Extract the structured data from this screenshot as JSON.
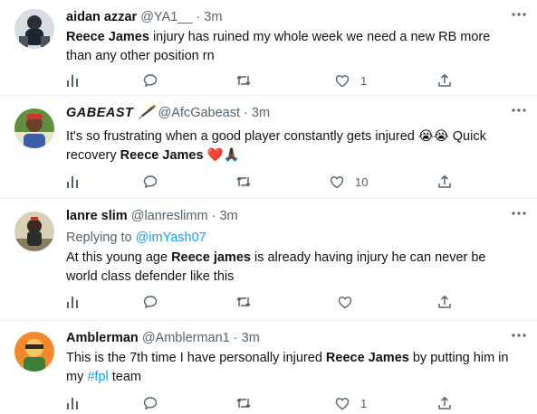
{
  "tweets": [
    {
      "name": "aidan azzar",
      "handle": "@YA1__",
      "dot": "·",
      "time": "3m",
      "text_parts": [
        "",
        "Reece James",
        " injury has ruined my whole week we need a new RB more than any other position rn"
      ],
      "like_count": "1",
      "retweet_count": "",
      "reply_count": ""
    },
    {
      "name": "GABEAST",
      "handle": "@AfcGabeast",
      "dot": "·",
      "time": "3m",
      "text_parts": [
        "It's so frustrating when a good player constantly gets injured ",
        "😭😭",
        " Quick recovery ",
        "Reece James",
        " ",
        "❤️🙏🏿"
      ],
      "like_count": "10",
      "retweet_count": "",
      "reply_count": ""
    },
    {
      "name": "lanre slim",
      "handle": "@lanreslimm",
      "dot": "·",
      "time": "3m",
      "replying_to_label": "Replying to ",
      "replying_to_handle": "@imYash07",
      "text_parts": [
        "At this young age ",
        "Reece james",
        " is already having injury he can never be world class defender like this"
      ],
      "like_count": "",
      "retweet_count": "",
      "reply_count": ""
    },
    {
      "name": "Amblerman",
      "handle": "@Amblerman1",
      "dot": "·",
      "time": "3m",
      "text_parts": [
        "This is the 7th time I have personally injured ",
        "Reece James",
        " by putting him in my ",
        "#fpl",
        " team"
      ],
      "like_count": "1",
      "retweet_count": "",
      "reply_count": ""
    }
  ],
  "icons": [
    "stats-icon",
    "reply-icon",
    "retweet-icon",
    "like-icon",
    "share-icon",
    "more-icon"
  ],
  "colors": {
    "text": "#0f1419",
    "muted": "#536471",
    "link": "#1d9bf0",
    "divider": "#eff3f4"
  }
}
